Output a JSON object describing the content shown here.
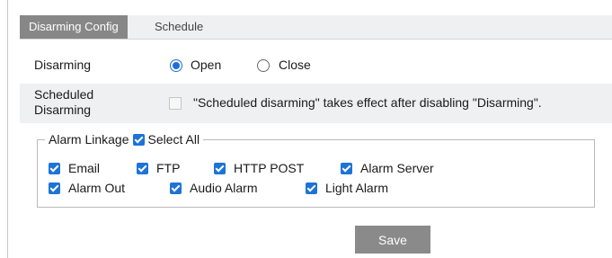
{
  "tabs": [
    {
      "label": "Disarming Config",
      "active": true
    },
    {
      "label": "Schedule",
      "active": false
    }
  ],
  "disarming": {
    "label": "Disarming",
    "options": [
      {
        "label": "Open",
        "selected": true
      },
      {
        "label": "Close",
        "selected": false
      }
    ]
  },
  "scheduled": {
    "label_line1": "Scheduled",
    "label_line2": "Disarming",
    "checked": false,
    "note": "\"Scheduled disarming\" takes effect after disabling \"Disarming\"."
  },
  "alarm_linkage": {
    "legend": "Alarm Linkage",
    "select_all_label": "Select All",
    "select_all_checked": true,
    "options": [
      {
        "label": "Email",
        "checked": true
      },
      {
        "label": "FTP",
        "checked": true
      },
      {
        "label": "HTTP POST",
        "checked": true
      },
      {
        "label": "Alarm Server",
        "checked": true
      },
      {
        "label": "Alarm Out",
        "checked": true
      },
      {
        "label": "Audio Alarm",
        "checked": true
      },
      {
        "label": "Light Alarm",
        "checked": true
      }
    ]
  },
  "save_label": "Save",
  "colors": {
    "accent": "#1e73d6",
    "tab_active_bg": "#878787",
    "save_bg": "#8a8a8a",
    "panel_bg": "#eef0f2"
  }
}
